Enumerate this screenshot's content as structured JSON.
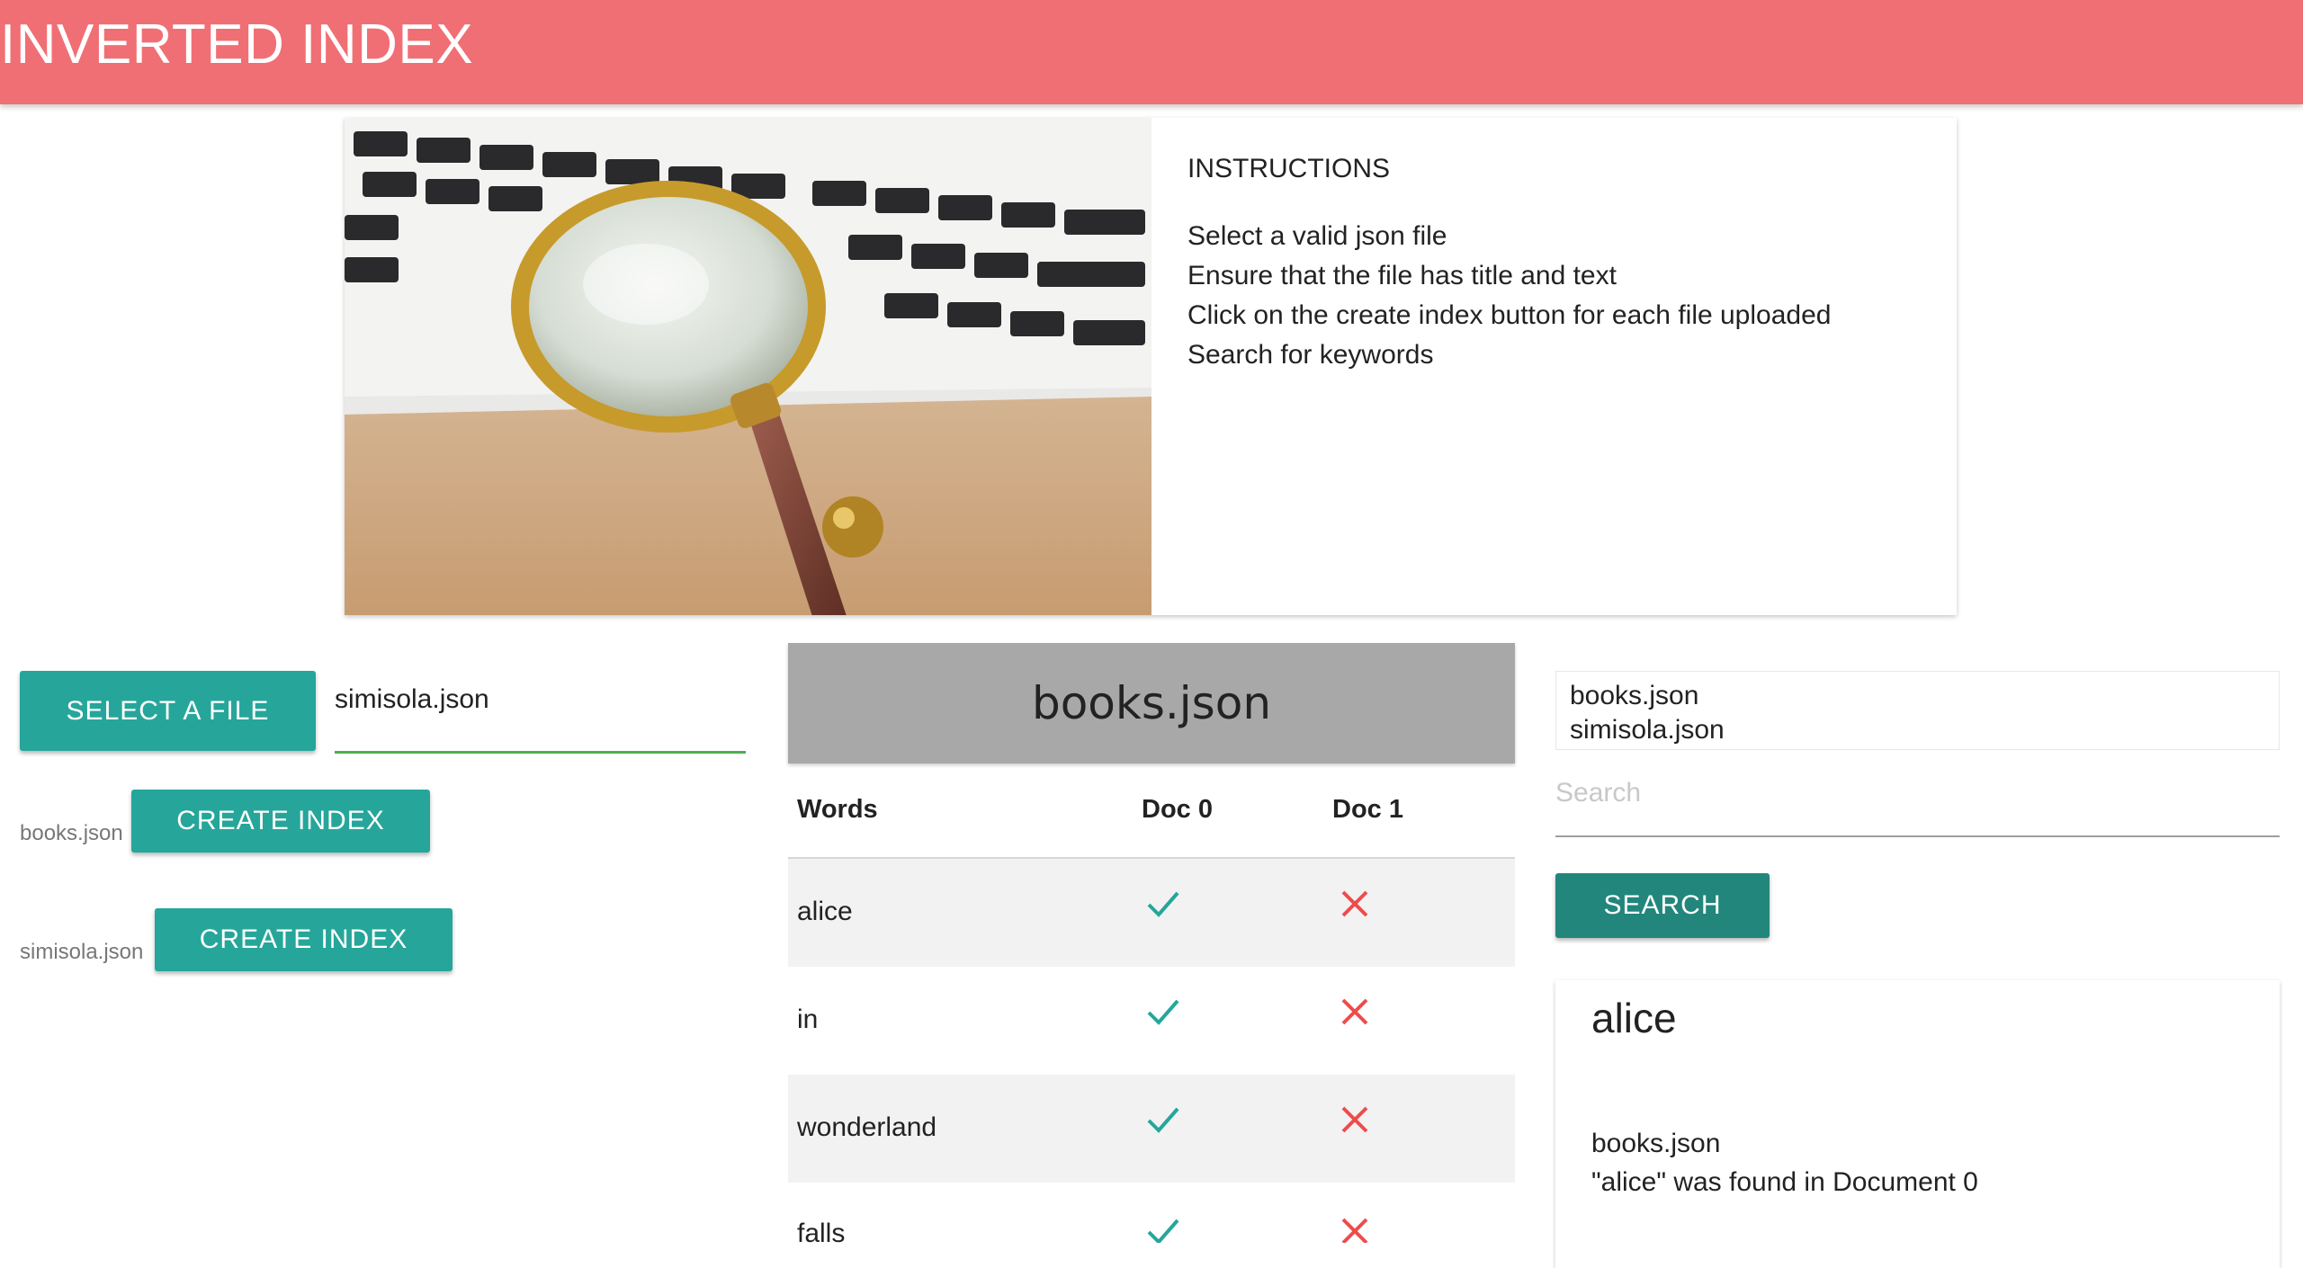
{
  "app": {
    "title": "INVERTED INDEX",
    "accent_color": "#f06f74",
    "button_color": "#26a69a"
  },
  "instructions": {
    "title": "INSTRUCTIONS",
    "lines": [
      "Select a valid json file",
      "Ensure that the file has title and text",
      "Click on the create index button for each file uploaded",
      "Search for keywords"
    ]
  },
  "upload": {
    "select_label": "SELECT A FILE",
    "selected_file": "simisola.json",
    "files": [
      {
        "name": "books.json",
        "button_label": "CREATE INDEX"
      },
      {
        "name": "simisola.json",
        "button_label": "CREATE INDEX"
      }
    ]
  },
  "index_table": {
    "file_title": "books.json",
    "headers": [
      "Words",
      "Doc 0",
      "Doc 1"
    ],
    "rows": [
      {
        "word": "alice",
        "doc0": "check-icon",
        "doc1": "cross-icon"
      },
      {
        "word": "in",
        "doc0": "check-icon",
        "doc1": "cross-icon"
      },
      {
        "word": "wonderland",
        "doc0": "check-icon",
        "doc1": "cross-icon"
      },
      {
        "word": "falls",
        "doc0": "check-icon",
        "doc1": "cross-icon"
      }
    ]
  },
  "search": {
    "file_options": [
      "books.json",
      "simisola.json"
    ],
    "placeholder": "Search",
    "value": "",
    "button_label": "SEARCH"
  },
  "result": {
    "word": "alice",
    "file": "books.json",
    "message": "\"alice\" was found in Document 0"
  }
}
